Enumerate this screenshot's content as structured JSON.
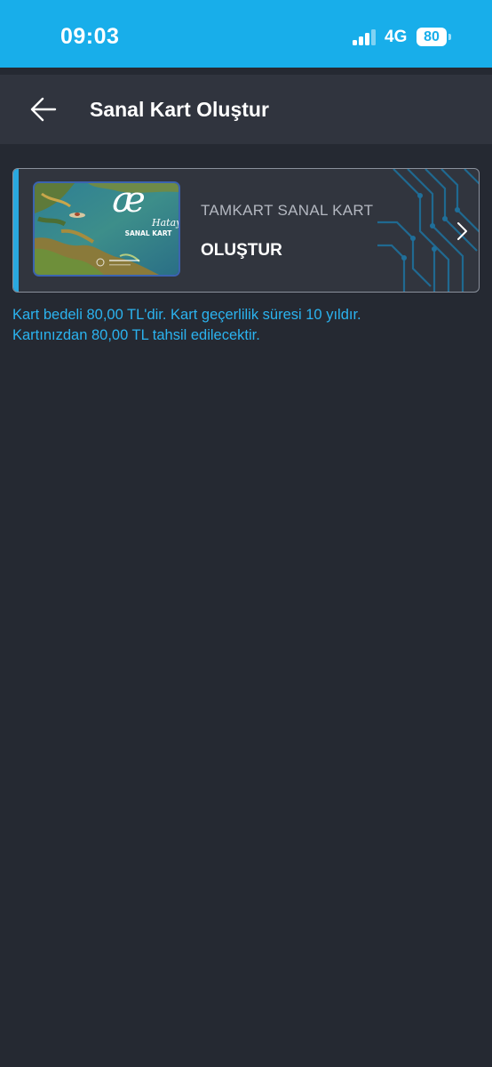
{
  "status_bar": {
    "time": "09:03",
    "network": "4G",
    "battery": "80",
    "signal_bars_active": 3,
    "signal_bars_total": 4,
    "background_color": "#18aeea"
  },
  "header": {
    "back_icon": "arrow-left-icon",
    "title": "Sanal Kart Oluştur"
  },
  "card": {
    "thumbnail_logo_text": "Hatay",
    "thumbnail_caption": "SANAL KART",
    "subtitle": "TAMKART SANAL KART",
    "action": "OLUŞTUR",
    "chevron_icon": "chevron-right-icon",
    "accent_color": "#29a8df"
  },
  "info": {
    "line1": "Kart bedeli 80,00 TL'dir. Kart geçerlilik süresi 10 yıldır.",
    "line2": "Kartınızdan 80,00 TL tahsil edilecektir.",
    "color": "#2bb3ef"
  }
}
